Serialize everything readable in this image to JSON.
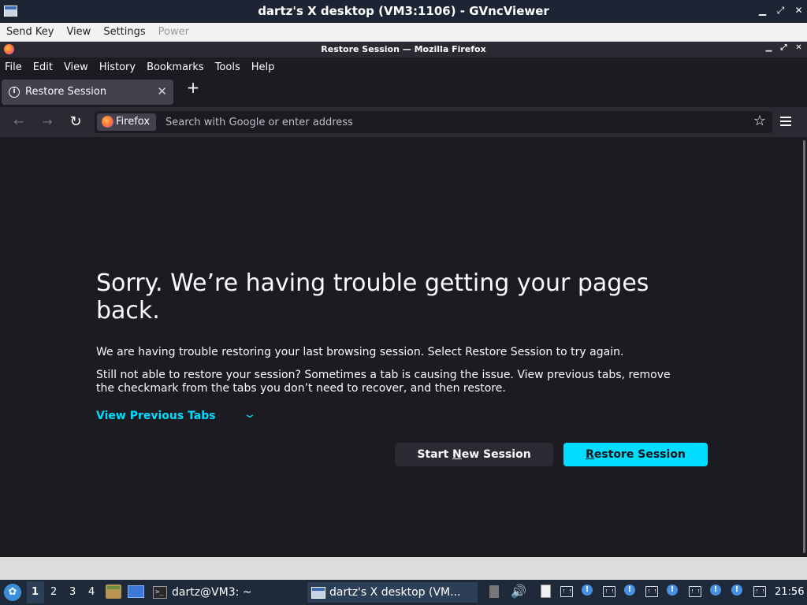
{
  "vnc": {
    "title": "dartz's X desktop (VM3:1106) - GVncViewer",
    "menu": [
      "Send Key",
      "View",
      "Settings",
      "Power"
    ],
    "controls": {
      "minimize": "▁",
      "restore": "⤢",
      "close": "✕"
    }
  },
  "firefox": {
    "window_title": "Restore Session — Mozilla Firefox",
    "menubar": [
      "File",
      "Edit",
      "View",
      "History",
      "Bookmarks",
      "Tools",
      "Help"
    ],
    "tab": {
      "label": "Restore Session",
      "close": "✕"
    },
    "new_tab": "+",
    "nav": {
      "back": "←",
      "forward": "→",
      "reload": "↻"
    },
    "urlbar": {
      "identity": "Firefox",
      "placeholder": "Search with Google or enter address",
      "value": ""
    },
    "bookmark_star": "☆"
  },
  "page": {
    "title": "Sorry. We’re having trouble getting your pages back.",
    "paragraph1": "We are having trouble restoring your last browsing session. Select Restore Session to try again.",
    "paragraph2": "Still not able to restore your session? Sometimes a tab is causing the issue. View previous tabs, remove the checkmark from the tabs you don’t need to recover, and then restore.",
    "view_previous": "View Previous Tabs",
    "start_new": {
      "before": "Start ",
      "access": "N",
      "after": "ew Session"
    },
    "restore": {
      "access": "R",
      "after": "estore Session"
    }
  },
  "taskbar": {
    "start_glyph": "✿",
    "workspaces": [
      "1",
      "2",
      "3",
      "4"
    ],
    "active_workspace": "1",
    "terminal_glyph": ">_",
    "tasks": [
      {
        "label": "dartz@VM3: ~",
        "icon": "terminal-icon"
      },
      {
        "label": "dartz's X desktop (VM...",
        "icon": "vnc-icon"
      }
    ],
    "speaker_glyph": "🔊",
    "alert_glyph": "!",
    "clock": "21:56"
  }
}
